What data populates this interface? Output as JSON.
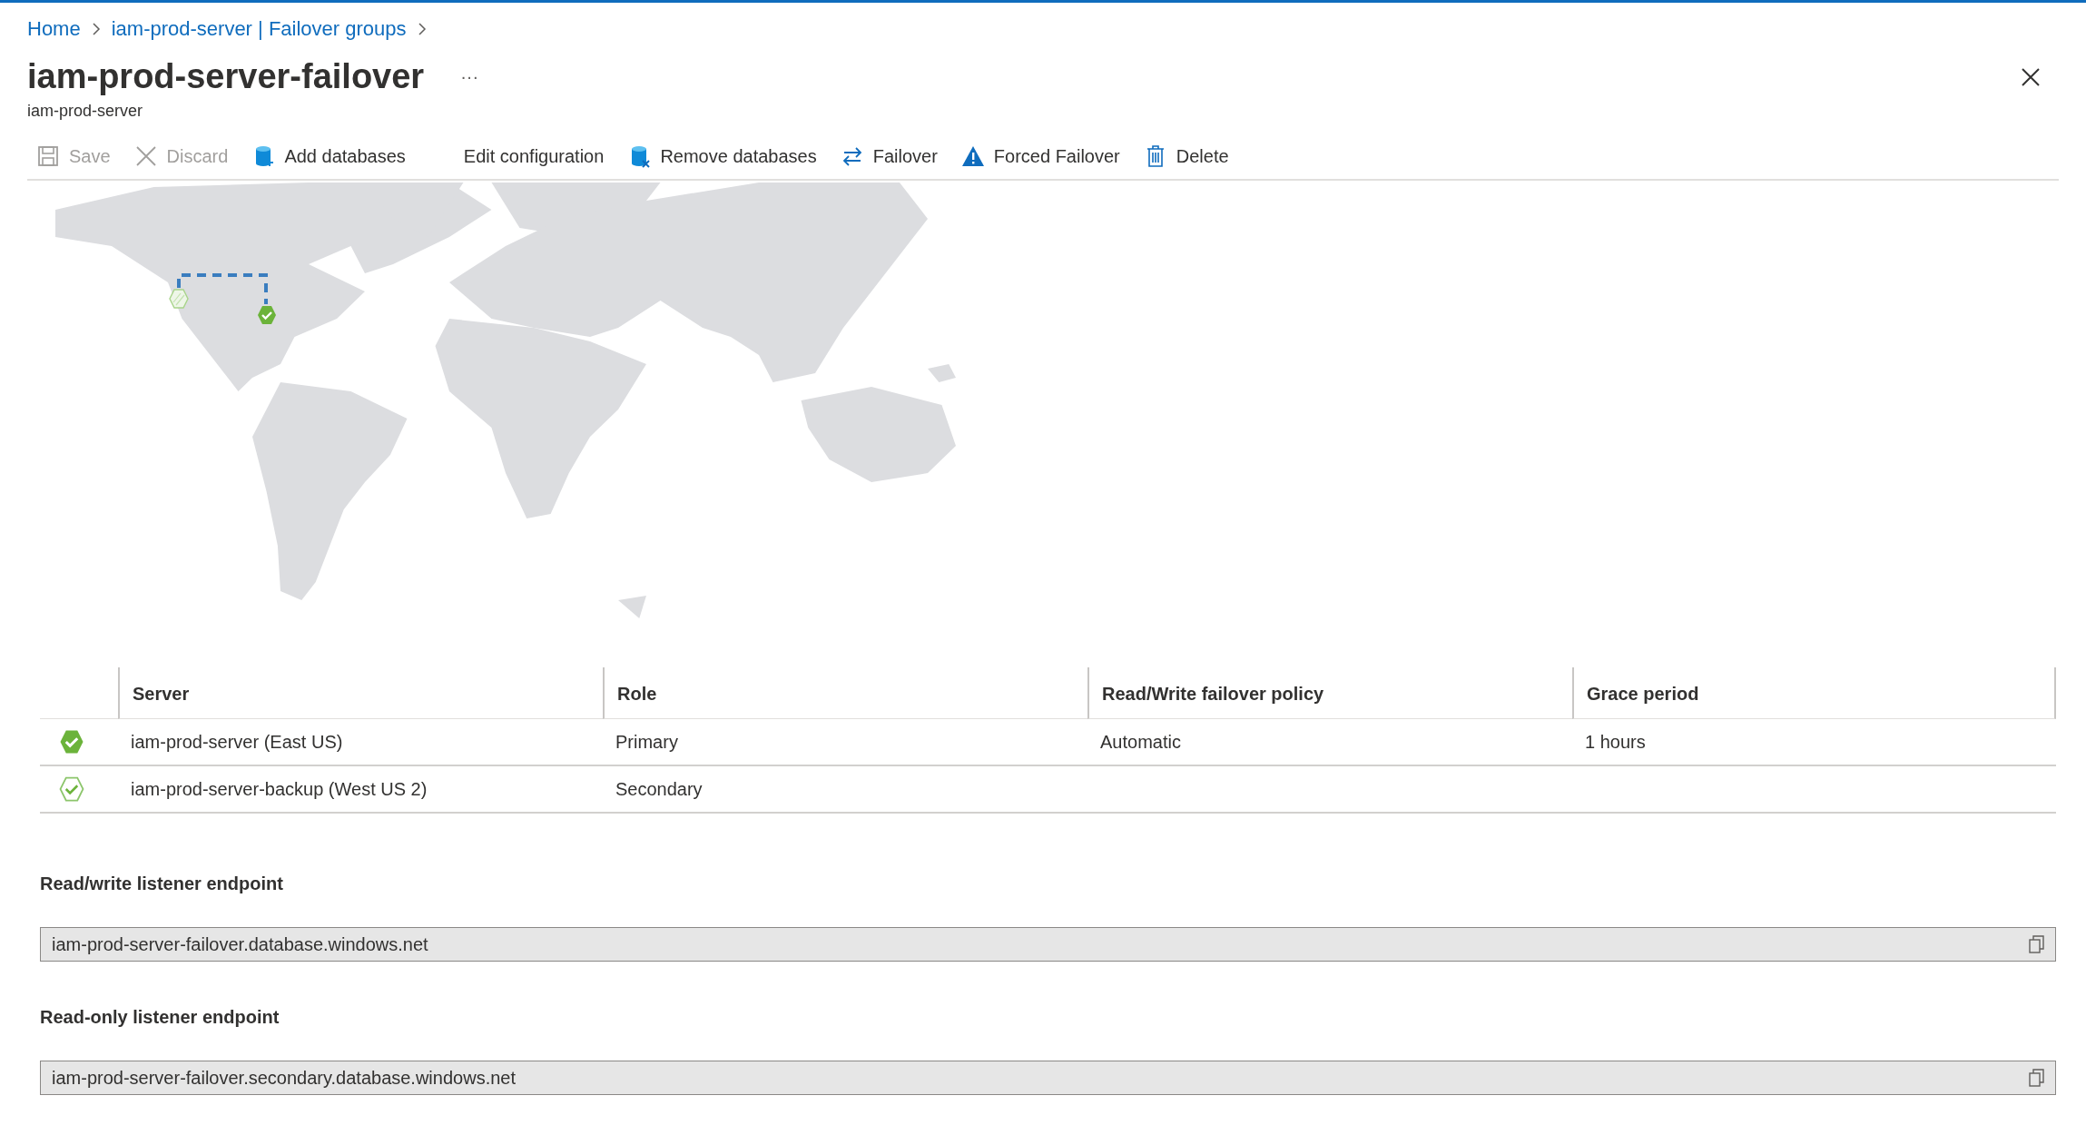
{
  "breadcrumb": [
    {
      "label": "Home"
    },
    {
      "label": "iam-prod-server | Failover groups"
    }
  ],
  "title": "iam-prod-server-failover",
  "more": "···",
  "subtitle": "iam-prod-server",
  "toolbar": [
    {
      "label": "Save",
      "kind": "save",
      "disabled": true
    },
    {
      "label": "Discard",
      "kind": "discard",
      "disabled": true
    },
    {
      "label": "Add databases",
      "kind": "add",
      "disabled": false
    },
    {
      "label": "Edit configuration",
      "kind": "plain",
      "disabled": false
    },
    {
      "label": "Remove databases",
      "kind": "remove",
      "disabled": false
    },
    {
      "label": "Failover",
      "kind": "failover",
      "disabled": false
    },
    {
      "label": "Forced Failover",
      "kind": "warning",
      "disabled": false
    },
    {
      "label": "Delete",
      "kind": "delete",
      "disabled": false
    }
  ],
  "table": {
    "columns": [
      "Server",
      "Role",
      "Read/Write failover policy",
      "Grace period"
    ],
    "rows": [
      {
        "kind": "primary",
        "cells": [
          "iam-prod-server (East US)",
          "Primary",
          "Automatic",
          "1 hours"
        ]
      },
      {
        "kind": "secondary",
        "cells": [
          "iam-prod-server-backup (West US 2)",
          "Secondary",
          "",
          ""
        ]
      }
    ]
  },
  "endpoints": [
    {
      "label": "Read/write listener endpoint",
      "value": "iam-prod-server-failover.database.windows.net"
    },
    {
      "label": "Read-only listener endpoint",
      "value": "iam-prod-server-failover.secondary.database.windows.net"
    }
  ]
}
